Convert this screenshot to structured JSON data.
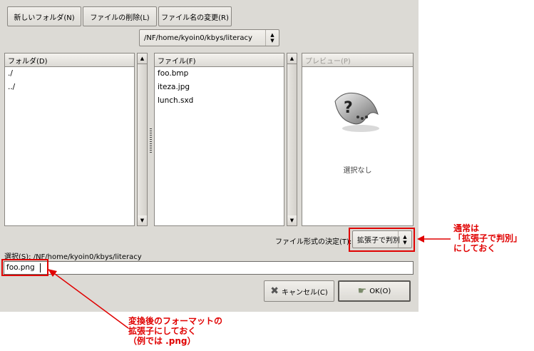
{
  "toolbar": {
    "new_folder": "新しいフォルダ(N)",
    "delete_file": "ファイルの削除(L)",
    "rename_file": "ファイル名の変更(R)"
  },
  "path_combo": {
    "value": "/NF/home/kyoin0/kbys/literacy"
  },
  "folders": {
    "header": "フォルダ(D)",
    "items": [
      "./",
      "../"
    ]
  },
  "files": {
    "header": "ファイル(F)",
    "items": [
      "foo.bmp",
      "iteza.jpg",
      "lunch.sxd"
    ]
  },
  "preview": {
    "header": "プレビュー(P)",
    "none_text": "選択なし"
  },
  "file_type": {
    "label": "ファイル形式の決定(T):",
    "value": "拡張子で判別"
  },
  "selection": {
    "label": "選択(S): /NF/home/kyoin0/kbys/literacy",
    "filename": "foo.png"
  },
  "actions": {
    "cancel": "キャンセル(C)",
    "ok": "OK(O)"
  },
  "annotations": {
    "right": [
      "通常は",
      "「拡張子で判別」",
      "にしておく"
    ],
    "bottom": [
      "変換後のフォーマットの",
      "拡張子にしておく",
      "（例では .png）"
    ]
  },
  "colors": {
    "annotation": "#e00000",
    "dialog_bg": "#dcdad5"
  }
}
